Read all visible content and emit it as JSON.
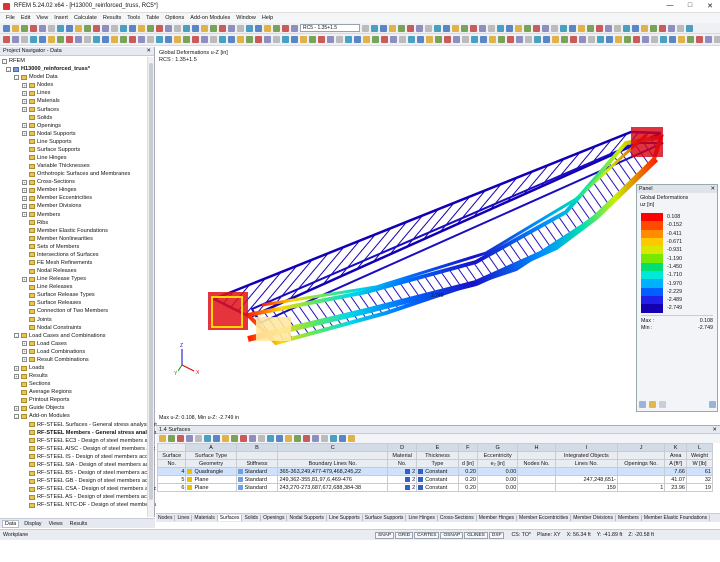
{
  "app": {
    "title": "RFEM 5.24.02 x64 - [H13000_reinforced_truss, RC5*]"
  },
  "menu": [
    "File",
    "Edit",
    "View",
    "Insert",
    "Calculate",
    "Results",
    "Tools",
    "Table",
    "Options",
    "Add-on Modules",
    "Window",
    "Help"
  ],
  "toolbar": {
    "combo1": "RC5 - 1.35+1.5"
  },
  "navigator": {
    "title": "Project Navigator - Data",
    "root": "RFEM",
    "project": "H13000_reinforced_truss*",
    "items": [
      {
        "l": "Model Data",
        "d": 1,
        "e": "-"
      },
      {
        "l": "Nodes",
        "d": 2,
        "e": "+"
      },
      {
        "l": "Lines",
        "d": 2,
        "e": "+"
      },
      {
        "l": "Materials",
        "d": 2,
        "e": "+"
      },
      {
        "l": "Surfaces",
        "d": 2,
        "e": "+"
      },
      {
        "l": "Solids",
        "d": 2,
        "e": ""
      },
      {
        "l": "Openings",
        "d": 2,
        "e": "+"
      },
      {
        "l": "Nodal Supports",
        "d": 2,
        "e": "+"
      },
      {
        "l": "Line Supports",
        "d": 2,
        "e": ""
      },
      {
        "l": "Surface Supports",
        "d": 2,
        "e": ""
      },
      {
        "l": "Line Hinges",
        "d": 2,
        "e": ""
      },
      {
        "l": "Variable Thicknesses",
        "d": 2,
        "e": ""
      },
      {
        "l": "Orthotropic Surfaces and Membranes",
        "d": 2,
        "e": ""
      },
      {
        "l": "Cross-Sections",
        "d": 2,
        "e": "+"
      },
      {
        "l": "Member Hinges",
        "d": 2,
        "e": "+"
      },
      {
        "l": "Member Eccentricities",
        "d": 2,
        "e": "+"
      },
      {
        "l": "Member Divisions",
        "d": 2,
        "e": "+"
      },
      {
        "l": "Members",
        "d": 2,
        "e": "+"
      },
      {
        "l": "Ribs",
        "d": 2,
        "e": ""
      },
      {
        "l": "Member Elastic Foundations",
        "d": 2,
        "e": ""
      },
      {
        "l": "Member Nonlinearities",
        "d": 2,
        "e": ""
      },
      {
        "l": "Sets of Members",
        "d": 2,
        "e": ""
      },
      {
        "l": "Intersections of Surfaces",
        "d": 2,
        "e": ""
      },
      {
        "l": "FE Mesh Refinements",
        "d": 2,
        "e": ""
      },
      {
        "l": "Nodal Releases",
        "d": 2,
        "e": ""
      },
      {
        "l": "Line Release Types",
        "d": 2,
        "e": "+"
      },
      {
        "l": "Line Releases",
        "d": 2,
        "e": ""
      },
      {
        "l": "Surface Release Types",
        "d": 2,
        "e": ""
      },
      {
        "l": "Surface Releases",
        "d": 2,
        "e": ""
      },
      {
        "l": "Connection of Two Members",
        "d": 2,
        "e": ""
      },
      {
        "l": "Joints",
        "d": 2,
        "e": ""
      },
      {
        "l": "Nodal Constraints",
        "d": 2,
        "e": ""
      },
      {
        "l": "Load Cases and Combinations",
        "d": 1,
        "e": "-"
      },
      {
        "l": "Load Cases",
        "d": 2,
        "e": "+"
      },
      {
        "l": "Load Combinations",
        "d": 2,
        "e": "+"
      },
      {
        "l": "Result Combinations",
        "d": 2,
        "e": "+"
      },
      {
        "l": "Loads",
        "d": 1,
        "e": "+"
      },
      {
        "l": "Results",
        "d": 1,
        "e": "+"
      },
      {
        "l": "Sections",
        "d": 1,
        "e": ""
      },
      {
        "l": "Average Regions",
        "d": 1,
        "e": ""
      },
      {
        "l": "Printout Reports",
        "d": 1,
        "e": ""
      },
      {
        "l": "Guide Objects",
        "d": 1,
        "e": "+"
      },
      {
        "l": "Add-on Modules",
        "d": 1,
        "e": "-"
      },
      {
        "l": "RF-STEEL Surfaces - General stress analysis of",
        "d": 2,
        "e": ""
      },
      {
        "l": "RF-STEEL Members - General stress analysis",
        "d": 2,
        "e": "",
        "b": 1
      },
      {
        "l": "RF-STEEL EC3 - Design of steel members acc",
        "d": 2,
        "e": ""
      },
      {
        "l": "RF-STEEL AISC - Design of steel members acc",
        "d": 2,
        "e": ""
      },
      {
        "l": "RF-STEEL IS - Design of steel members accor",
        "d": 2,
        "e": ""
      },
      {
        "l": "RF-STEEL SIA - Design of steel members acco",
        "d": 2,
        "e": ""
      },
      {
        "l": "RF-STEEL BS - Design of steel members acco",
        "d": 2,
        "e": ""
      },
      {
        "l": "RF-STEEL GB - Design of steel members acco",
        "d": 2,
        "e": ""
      },
      {
        "l": "RF-STEEL CSA - Design of steel members acco",
        "d": 2,
        "e": ""
      },
      {
        "l": "RF-STEEL AS - Design of steel members acco",
        "d": 2,
        "e": ""
      },
      {
        "l": "RF-STEEL NTC-DF - Design of steel members a",
        "d": 2,
        "e": ""
      }
    ],
    "tabs": [
      "Data",
      "Display",
      "Views",
      "Results"
    ]
  },
  "view": {
    "line1": "Global Deformations u-Z [in]",
    "line2": "RCS : 1.35+1.5",
    "footer": "Max u-Z: 0.108, Min u-Z: -2.749 in",
    "label": "2.749"
  },
  "panel": {
    "title": "Panel",
    "heading": "Global Deformations",
    "unit": "uz [in]",
    "legend": [
      "0.108",
      "-0.152",
      "-0.411",
      "-0.671",
      "-0.931",
      "-1.190",
      "-1.450",
      "-1.710",
      "-1.970",
      "-2.229",
      "-2.489",
      "-2.749"
    ],
    "colors": [
      "#ff0000",
      "#ff4a00",
      "#ff8c00",
      "#ffc800",
      "#d8e800",
      "#78e800",
      "#00e070",
      "#00e8d8",
      "#00b0ff",
      "#0060ff",
      "#2020e8",
      "#1400b0"
    ],
    "max_label": "Max :",
    "max": "0.108",
    "min_label": "Min :",
    "min": "-2.749"
  },
  "table": {
    "title": "1.4 Surfaces",
    "cols": [
      "A",
      "B",
      "C",
      "D",
      "E",
      "F",
      "G",
      "H",
      "I",
      "J",
      "K",
      "L"
    ],
    "h1": [
      "Surface",
      "Surface Type",
      "",
      "",
      "Material",
      "Thickness",
      "",
      "Eccentricity",
      "",
      "Integrated Objects",
      "",
      "Area",
      "Weight"
    ],
    "h2": [
      "No.",
      "Geometry",
      "Stiffness",
      "Boundary Lines No.",
      "No.",
      "Type",
      "d [in]",
      "e₂ [in]",
      "Nodes No.",
      "Lines No.",
      "Openings No.",
      "A [ft²]",
      "W [lb]"
    ],
    "rows": [
      [
        "4",
        "Quadrangle",
        "Standard",
        "365-363,249,477-479,468,245,22",
        "2",
        "Constant",
        "0.20",
        "0.00",
        "",
        "",
        "",
        "7.66",
        "61"
      ],
      [
        "5",
        "Plane",
        "Standard",
        "249,362-355,81,97,6,469-476",
        "2",
        "Constant",
        "0.20",
        "0.00",
        "",
        "247,248,651-",
        "",
        "41.07",
        "32"
      ],
      [
        "6",
        "Plane",
        "Standard",
        "243,270-273,687,672,688,384-38",
        "2",
        "Constant",
        "0.20",
        "0.00",
        "",
        "159",
        "1",
        "23.96",
        "19"
      ]
    ]
  },
  "bottom_tabs": [
    "Nodes",
    "Lines",
    "Materials",
    "Surfaces",
    "Solids",
    "Openings",
    "Nodal Supports",
    "Line Supports",
    "Surface Supports",
    "Line Hinges",
    "Cross-Sections",
    "Member Hinges",
    "Member Eccentricities",
    "Member Divisions",
    "Members",
    "Member Elastic Foundations"
  ],
  "status": {
    "left": "Workplane",
    "buttons": [
      "SNAP",
      "GRID",
      "CARTES",
      "OSNAP",
      "GLINES",
      "DXF"
    ],
    "cs": "CS: TO*",
    "plane": "Plane: XY",
    "x": "X: 56.34 ft",
    "y": "Y: -41.89 ft",
    "z": "Z: -20.58 ft"
  }
}
